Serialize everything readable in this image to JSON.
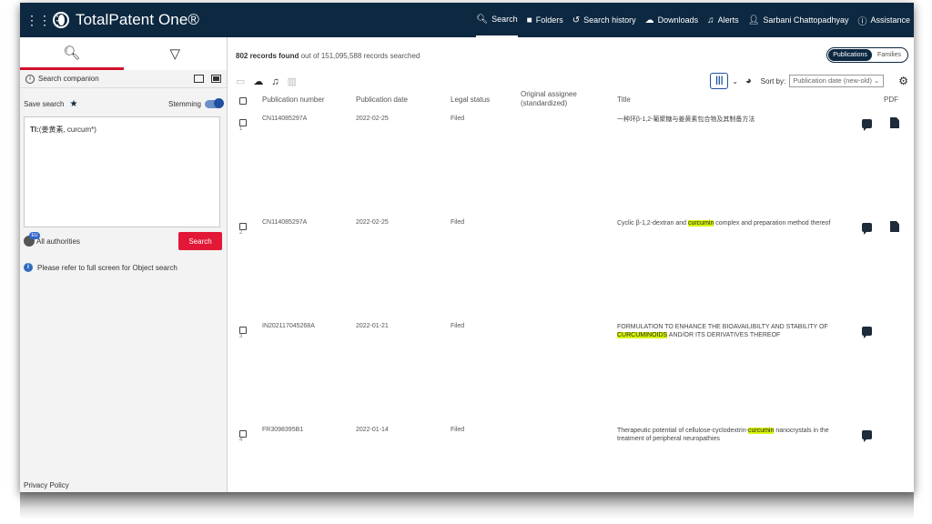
{
  "header": {
    "app_title": "TotalPatent One®",
    "nav": [
      {
        "label": "Search",
        "icon": "search-icon"
      },
      {
        "label": "Folders",
        "icon": "folder-icon"
      },
      {
        "label": "Search history",
        "icon": "history-icon"
      },
      {
        "label": "Downloads",
        "icon": "cloud-download-icon"
      },
      {
        "label": "Alerts",
        "icon": "bell-icon"
      },
      {
        "label": "Sarbani Chattopadhyay",
        "icon": "user-icon"
      },
      {
        "label": "Assistance",
        "icon": "info-icon"
      }
    ]
  },
  "sidebar": {
    "companion_label": "Search companion",
    "save_search_label": "Save search",
    "stemming_label": "Stemming",
    "query_prefix": "TI:",
    "query_text": "(姜黄素, curcum*)",
    "authorities_label": "All authorities",
    "authorities_badge": "EU",
    "search_button": "Search",
    "notice": "Please refer to full screen for Object search",
    "privacy": "Privacy Policy"
  },
  "results": {
    "records_count": "802 records found",
    "records_suffix": "out of 151,095,588 records searched",
    "toggle_publications": "Publications",
    "toggle_families": "Families",
    "sort_label": "Sort by:",
    "sort_value": "Publication date (new-old)",
    "columns": {
      "publication_number": "Publication number",
      "publication_date": "Publication date",
      "legal_status": "Legal status",
      "assignee": "Original assignee (standardized)",
      "title": "Title",
      "pdf": "PDF"
    },
    "rows": [
      {
        "num": "1",
        "pub_number": "CN114085297A",
        "pub_date": "2022-02-25",
        "status": "Filed",
        "title_before": "一种环β-1,2-葡聚糖与姜黄素包合物及其制备方法",
        "highlight": "",
        "title_after": "",
        "has_pdf": true
      },
      {
        "num": "2",
        "pub_number": "CN114085297A",
        "pub_date": "2022-02-25",
        "status": "Filed",
        "title_before": "Cyclic β-1,2-dextran and ",
        "highlight": "curcumin",
        "title_after": " complex and preparation method thereof",
        "has_pdf": true
      },
      {
        "num": "3",
        "pub_number": "IN202117045268A",
        "pub_date": "2022-01-21",
        "status": "Filed",
        "title_before": "FORMULATION TO ENHANCE THE BIOAVAILIBILTY AND STABILITY OF ",
        "highlight": "CURCUMINOIDS",
        "title_after": " AND/OR ITS DERIVATIVES THEREOF",
        "has_pdf": false
      },
      {
        "num": "4",
        "pub_number": "FR3098395B1",
        "pub_date": "2022-01-14",
        "status": "Filed",
        "title_before": "Therapeutic potential of cellulose-cyclodextrin-",
        "highlight": "curcumin",
        "title_after": " nanocrystals in the treatment of peripheral neuropathies",
        "has_pdf": false
      }
    ]
  },
  "colors": {
    "nav_bg": "#0d2841",
    "accent_red": "#e31837",
    "highlight": "#d9f50a"
  }
}
